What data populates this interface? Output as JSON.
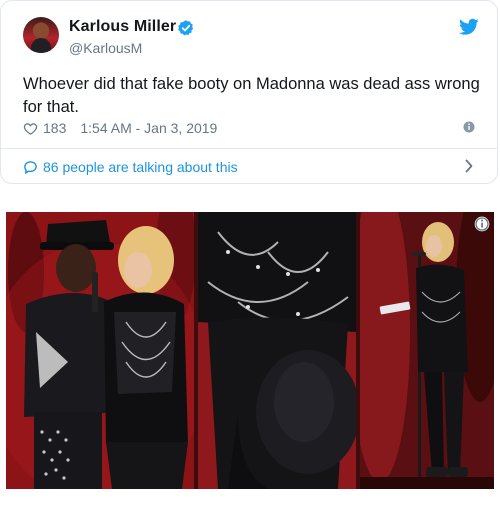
{
  "tweet": {
    "display_name": "Karlous Miller",
    "handle": "@KarlousM",
    "verified": true,
    "text": "Whoever did that fake booty on Madonna was dead ass wrong for that.",
    "likes": "183",
    "timestamp": "1:54 AM - Jan 3, 2019",
    "talking": "86 people are talking about this"
  },
  "icons": {
    "verified": "verified-badge-icon",
    "brand": "twitter-bird-icon",
    "like": "heart-icon",
    "info": "info-icon",
    "conversation": "speech-bubble-icon",
    "chevron": "chevron-right-icon",
    "photo_info": "info-badge-icon"
  },
  "colors": {
    "accent": "#1da1f2",
    "link": "#1b95e0",
    "text": "#14171a",
    "secondary": "#657786",
    "border": "#e1e8ed"
  }
}
